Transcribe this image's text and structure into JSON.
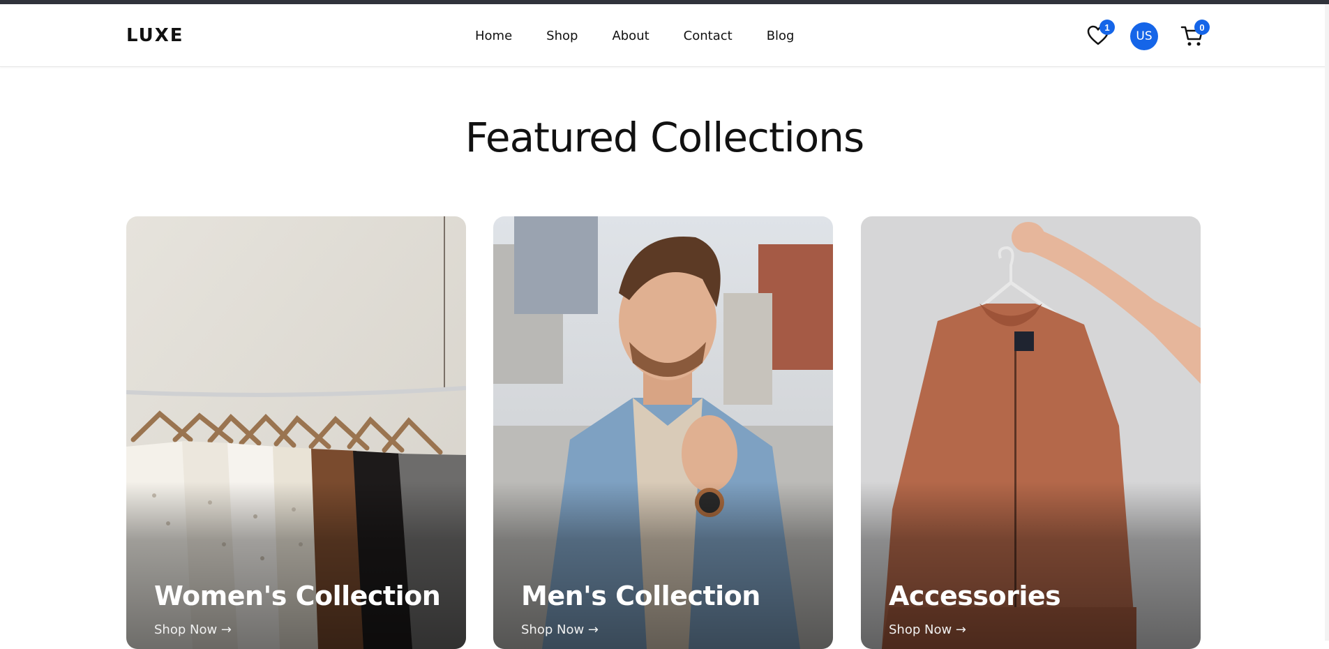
{
  "header": {
    "logo": "LUXE",
    "nav": [
      "Home",
      "Shop",
      "About",
      "Contact",
      "Blog"
    ],
    "wishlist_count": "1",
    "avatar_initials": "US",
    "cart_count": "0",
    "accent_color": "#1565e8"
  },
  "main": {
    "title": "Featured Collections",
    "collections": [
      {
        "title": "Women's Collection",
        "link": "Shop Now →"
      },
      {
        "title": "Men's Collection",
        "link": "Shop Now →"
      },
      {
        "title": "Accessories",
        "link": "Shop Now →"
      }
    ]
  }
}
